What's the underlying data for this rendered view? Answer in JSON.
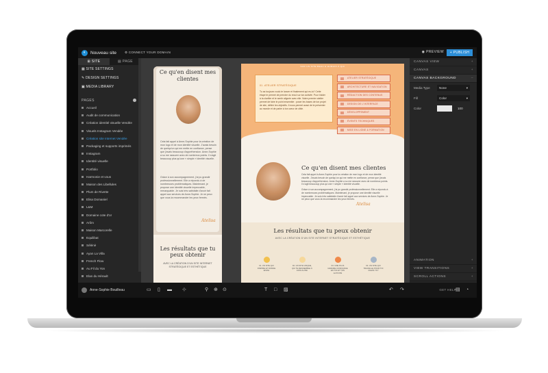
{
  "app": {
    "site_name": "Nouveau site",
    "connect_domain": "CONNECT YOUR DOMAIN",
    "preview": "PREVIEW",
    "publish": "+ PUBLISH"
  },
  "left_panel": {
    "tabs": [
      "SITE",
      "PAGE"
    ],
    "items": [
      "SITE SETTINGS",
      "DESIGN SETTINGS",
      "MEDIA LIBRARY"
    ],
    "pages_heading": "PAGES",
    "pages": [
      "Accueil",
      "Audit de communication",
      "Création identité visuelle Vendée",
      "Visuels Instagram Vendée",
      "Création site Internet Vendée",
      "Packaging et supports imprimés",
      "Instagram",
      "Identité visuelle",
      "Portfolio",
      "Harmonie et vous",
      "Maison des Libellules",
      "Plum de Rivette",
      "Elisa Domaniel",
      "L&M",
      "Domaine cote d'or",
      "Arôm",
      "Maison Marcorelle",
      "Equilibat",
      "Sélénè",
      "Ayan La Villa",
      "French Flow",
      "Au Fil du Yon",
      "Elan du Hérault"
    ],
    "active_page_index": 4
  },
  "bottom_bar": {
    "username": "Anne-Sophie Bouilleau",
    "get_help": "GET HELP"
  },
  "mobile_preview": {
    "title_line1": "Ce qu'en disent mes",
    "title_line2": "clientes",
    "paragraph1": "Cela fait appel à Anne-Sophie pour la création de mon logo et de mon identité visuelle. J'avais besoin de quelqu'un qui me mette en confiance, pense que j'avais beaucoup d'appréhension. Anne-Sophie a su me rassurer avec de nombreux points. Il s'agit beaucoup plus qu'une « simple » identité visuelle.",
    "paragraph2": "Grâce à son accompagnement, j'ai pu grandir professionnellement. Elle a répondu à de nombreuses problématiques. Maintenant, je propose une identité visuelle impeccable, remarquable. Je suis très satisfaite d'avoir fait appel aux services de Anne-Sophie. Je ne peux que vous la recommander les yeux fermés.",
    "signature": "Atelisa",
    "results_title": "Les résultats que tu peux obtenir",
    "results_subtitle": "AVEC LA CRÉATION D'UN SITE INTERNET STRATÉGIQUE ET ESTHÉTIQUE"
  },
  "desktop_preview": {
    "header_strip": "SUR UN SITE BEAU & HUMAIN À QUI",
    "box_title": "01. ATELIER STRATÉGIQUE",
    "box_text": "Tu as toujours voulu te lancer et finalement qui es-tu? Cette étape te permet de prendre du recul sur ton activité. Pour t'aider à la clarifier et te sentir alignée avec elle. Notre premier atelier permet de faire le point ensemble : poser les bases de ton projet de site, définir les objectifs. Il nous permet aussi de te présenter au monde et de parler à ton cœur de cible.",
    "list": [
      "ATELIER STRATÉGIQUE",
      "ARCHITECTURE ET NAVIGATION",
      "RÉDACTION DES CONTENUS",
      "DESIGN DE L'INTERFACE",
      "DÉVELOPPEMENT",
      "ÉVENTS TECHNIQUES",
      "MISE EN LIGNE & FORMATION"
    ],
    "testimonial_heading": "Ce qu'en disent mes clientes",
    "para1": "Cela fait appel à Anne-Sophie pour la création de mon logo et de mon identité visuelle. J'avais besoin de quelqu'un qui me mette en confiance, pense que j'avais beaucoup d'appréhension. Anne-Sophie a su me rassurer avec de nombreux points. Il s'agit beaucoup plus qu'une « simple » identité visuelle.",
    "para2": "Grâce à son accompagnement, j'ai pu grandir professionnellement. Elle a répondu à de nombreuses problématiques. Maintenant, je propose une identité visuelle impeccable. Je suis très satisfaite d'avoir fait appel aux services de Anne-Sophie. Je ne peux que vous la recommander les yeux fermés.",
    "signature": "Atelisa",
    "results_title": "Les résultats que tu peux obtenir",
    "results_subtitle": "AVEC LA CRÉATION D'UN SITE INTERNET STRATÉGIQUE ET ESTHÉTIQUE",
    "results": [
      {
        "text": "01. UN SITE QUI INSPIRE ET DONNE ENVIE",
        "icon": "smile-icon",
        "color": "#f2c14e"
      },
      {
        "text": "02. UN SITE UNIQUE, QUI TE RESSEMBLE À 100% AUSSI",
        "icon": "sparkle-icon",
        "color": "#f6d89b"
      },
      {
        "text": "03. UNE PLUS GRANDE CONFIANCE EN TOI ET TON ACTIVITÉ",
        "icon": "fire-icon",
        "color": "#f08a4b"
      },
      {
        "text": "04. UN SITE QUI TRAVAILLE POUR TOI 24H/24 7J/7",
        "icon": "gear-icon",
        "color": "#a7b6c7"
      }
    ]
  },
  "right_panel": {
    "sections": [
      "CANVAS VIEW",
      "CANVAS",
      "CANVAS BACKGROUND"
    ],
    "media_type_label": "Media Type",
    "media_type_value": "None",
    "fill_label": "Fill",
    "fill_value": "Color",
    "color_label": "Color",
    "color_opacity": "100",
    "bottom_sections": [
      "ANIMATION",
      "VIEW TRANSITIONS",
      "SCROLL ACTIONS"
    ]
  },
  "colors": {
    "accent": "#2d8fd8",
    "orange": "#f5b57a",
    "cream": "#f7f1e8"
  }
}
